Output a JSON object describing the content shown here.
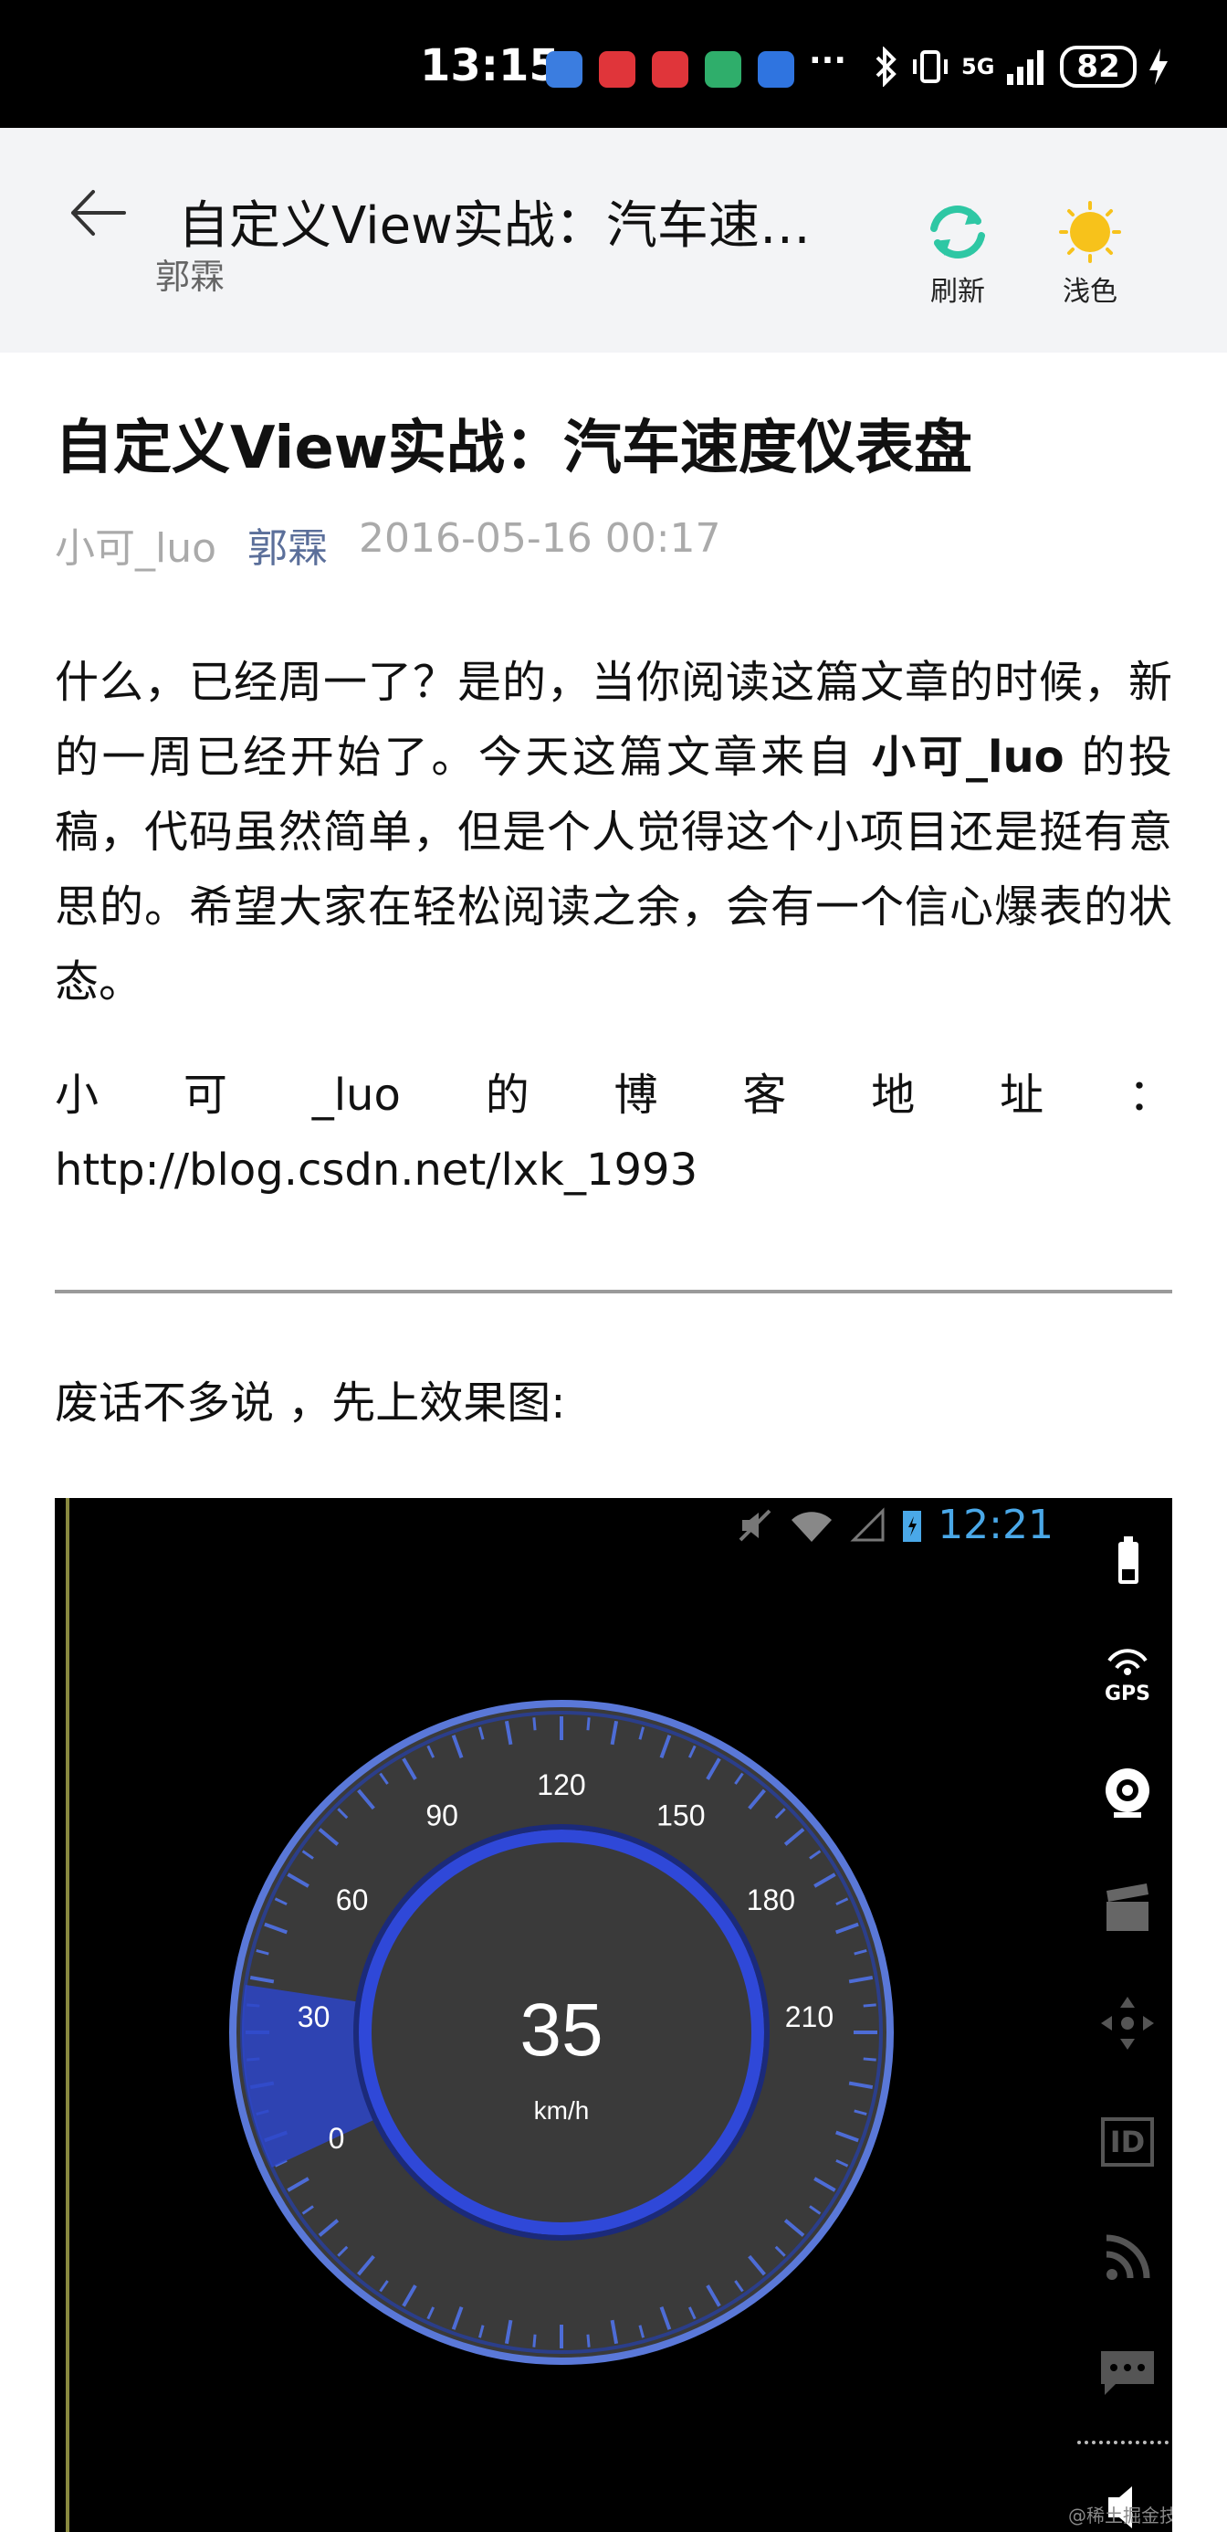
{
  "status_bar": {
    "time": "13:15",
    "network": "5G",
    "battery": "82",
    "app_icon_colors": [
      "#3b7de0",
      "#e0353a",
      "#e0353a",
      "#2fae6b",
      "#2f74e0"
    ],
    "icons": [
      "usb-icon",
      "huawei-app-icon",
      "huawei-app-icon",
      "home-app-icon",
      "browser-app-icon",
      "more-icon",
      "bluetooth-icon",
      "vibrate-icon",
      "signal-icon",
      "charging-icon"
    ]
  },
  "header": {
    "title": "自定义View实战：汽车速度仪表盘",
    "subtitle": "郭霖",
    "refresh_label": "刷新",
    "theme_label": "浅色",
    "accent_color": "#2ec7a4",
    "sun_color": "#f7c21b"
  },
  "article": {
    "title": "自定义View实战：汽车速度仪表盘",
    "meta": {
      "source": "小可_luo",
      "author": "郭霖",
      "date": "2016-05-16 00:17"
    },
    "para1_before": "什么，已经周一了？是的，当你阅读这篇文章的时候，新的一周已经开始了。今天这篇文章来自 ",
    "para1_bold": "小可_luo",
    "para1_after": " 的投稿，代码虽然简单，但是个人觉得这个小项目还是挺有意思的。希望大家在轻松阅读之余，会有一个信心爆表的状态。",
    "blog_label_chars": [
      "小",
      "可",
      "_luo",
      "的",
      "博",
      "客",
      "地",
      "址",
      "："
    ],
    "blog_url": "http://blog.csdn.net/lxk_1993",
    "intro": "废话不多说 ，先上效果图:"
  },
  "screenshot": {
    "time": "12:21",
    "speed": "35",
    "unit": "km/h",
    "tick_labels": [
      "0",
      "30",
      "60",
      "90",
      "120",
      "150",
      "180",
      "210"
    ],
    "gps_label": "GPS",
    "id_label": "ID",
    "watermark": "@稀土掘金技术社区",
    "side_icons": [
      "battery-icon",
      "gps-icon",
      "camera-icon",
      "clapper-icon",
      "move-icon",
      "id-icon",
      "rss-icon",
      "message-icon",
      "volume-icon"
    ]
  }
}
